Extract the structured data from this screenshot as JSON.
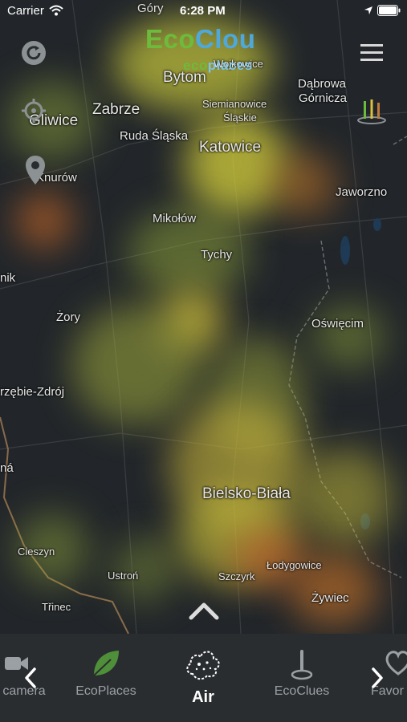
{
  "status_bar": {
    "carrier": "Carrier",
    "time": "6:28 PM",
    "overlay_place": "Góry"
  },
  "logo": {
    "part1": "Eco",
    "part2": "Clou",
    "sub1": "eco",
    "sub2": "places"
  },
  "places": {
    "wojkowice": "Wojkowice",
    "bytom": "Bytom",
    "dabrowa1": "Dąbrowa",
    "dabrowa2": "Górnicza",
    "zabrze": "Zabrze",
    "gliwice": "Gliwice",
    "siemianowice1": "Siemianowice",
    "siemianowice2": "Śląskie",
    "ruda": "Ruda Śląska",
    "katowice": "Katowice",
    "knurow": "Knurów",
    "jaworzno": "Jaworzno",
    "mikolow": "Mikołów",
    "tychy": "Tychy",
    "nik": "nik",
    "zory": "Żory",
    "oswiecim": "Oświęcim",
    "zdroj": "rzębie-Zdrój",
    "na": "ná",
    "bielsko": "Bielsko-Biała",
    "cieszyn": "Cieszyn",
    "lodygowice": "Łodygowice",
    "ustron": "Ustroń",
    "szczyrk": "Szczyrk",
    "zywiec": "Żywiec",
    "trinec": "Třinec"
  },
  "tabs": [
    {
      "label": "camera",
      "icon": "video-camera-icon",
      "active": false
    },
    {
      "label": "EcoPlaces",
      "icon": "leaf-icon",
      "active": false
    },
    {
      "label": "Air",
      "icon": "air-cloud-icon",
      "active": true
    },
    {
      "label": "EcoClues",
      "icon": "pin-clue-icon",
      "active": false
    },
    {
      "label": "Favor",
      "icon": "heart-icon",
      "active": false
    }
  ],
  "colors": {
    "eco_green": "#6dbb3d",
    "clou_blue": "#4fa8dc",
    "tabbar_bg": "#2a2d30",
    "map_bg": "#22262a"
  }
}
